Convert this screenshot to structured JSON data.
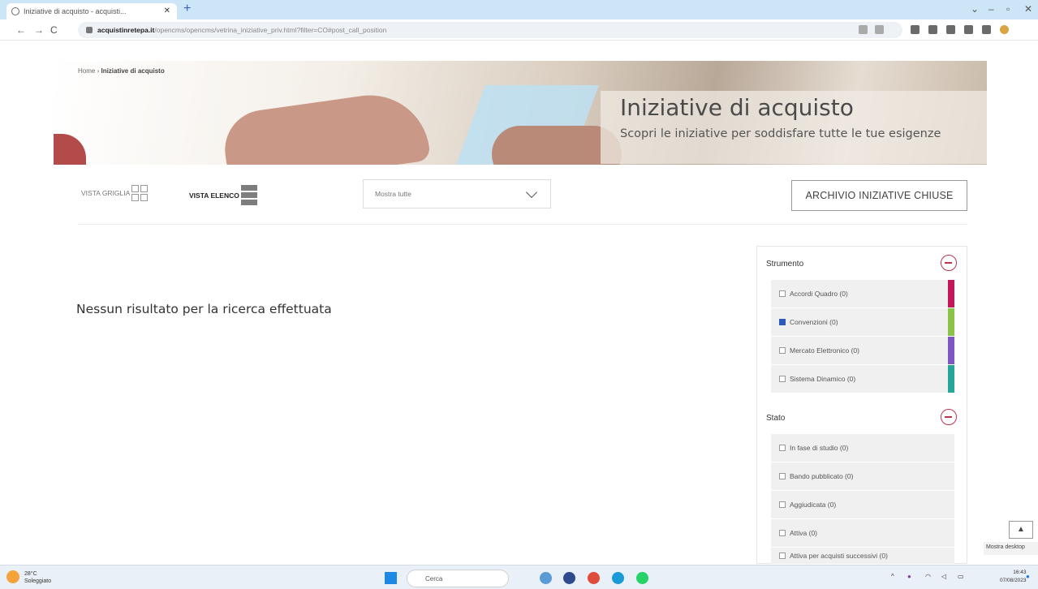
{
  "browser": {
    "tab_title": "Iniziative di acquisto - acquisti...",
    "url_host": "acquistinretepa.it",
    "url_path": "/opencms/opencms/vetrina_iniziative_priv.html?filter=CO#post_call_position"
  },
  "breadcrumb": {
    "home": "Home",
    "current": "Iniziative di acquisto"
  },
  "hero": {
    "title": "Iniziative di acquisto",
    "subtitle": "Scopri le iniziative per soddisfare tutte le tue esigenze"
  },
  "controls": {
    "grid_label": "VISTA GRIGLIA",
    "list_label": "VISTA ELENCO",
    "dropdown_value": "Mostra tutte",
    "archive_button": "ARCHIVIO INIZIATIVE CHIUSE"
  },
  "main": {
    "no_result": "Nessun risultato per la ricerca effettuata"
  },
  "filters": {
    "strumento": {
      "title": "Strumento",
      "items": [
        {
          "label": "Accordi Quadro (0)",
          "checked": false,
          "color": "#c2185b"
        },
        {
          "label": "Convenzioni (0)",
          "checked": true,
          "color": "#8bc34a"
        },
        {
          "label": "Mercato Elettronico (0)",
          "checked": false,
          "color": "#7e57c2"
        },
        {
          "label": "Sistema Dinamico (0)",
          "checked": false,
          "color": "#26a69a"
        }
      ]
    },
    "stato": {
      "title": "Stato",
      "items": [
        {
          "label": "In fase di studio (0)"
        },
        {
          "label": "Bando pubblicato (0)"
        },
        {
          "label": "Aggiudicata (0)"
        },
        {
          "label": "Attiva (0)"
        },
        {
          "label": "Attiva per acquisti successivi (0)"
        }
      ]
    }
  },
  "overlay": {
    "scroll_top": "▲",
    "mostra_desktop": "Mostra desktop"
  },
  "taskbar": {
    "temp": "28°C",
    "weather": "Soleggiato",
    "search": "Cerca",
    "time": "16:43",
    "date": "07/08/2023"
  }
}
